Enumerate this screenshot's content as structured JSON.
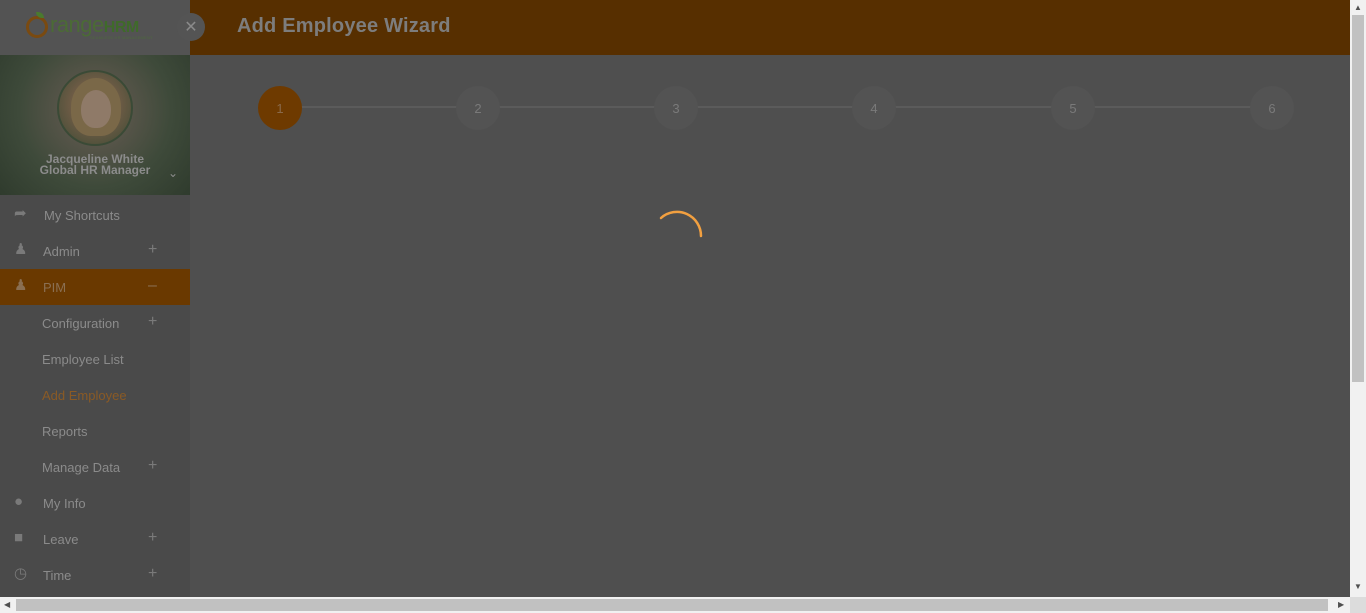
{
  "header": {
    "title": "Add Employee Wizard"
  },
  "wizard": {
    "steps": [
      "1",
      "2",
      "3",
      "4",
      "5",
      "6"
    ],
    "active_step": 1
  },
  "brand": {
    "logo_main": "range",
    "logo_hrm": "HRM",
    "logo_tagline": "SEAMLESS HR MANAGEMENT",
    "close_icon": "close-icon",
    "primary_color": "#f28c00"
  },
  "profile": {
    "name": "Jacqueline White",
    "role": "Global HR Manager"
  },
  "menu": {
    "shortcuts": "My Shortcuts",
    "admin": "Admin",
    "pim": "PIM",
    "configuration": "Configuration",
    "employee_list": "Employee List",
    "add_employee": "Add Employee",
    "reports": "Reports",
    "manage_data": "Manage Data",
    "my_info": "My Info",
    "leave": "Leave",
    "time": "Time"
  },
  "state": {
    "loading": true
  }
}
